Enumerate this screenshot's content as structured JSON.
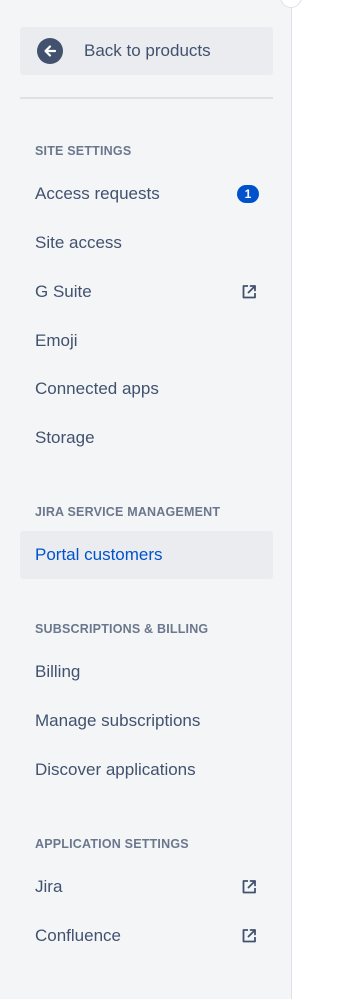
{
  "back": {
    "label": "Back to products"
  },
  "sections": {
    "site_settings": {
      "heading": "SITE SETTINGS",
      "items": [
        {
          "label": "Access requests",
          "badge": "1"
        },
        {
          "label": "Site access"
        },
        {
          "label": "G Suite",
          "icon": "external-link-icon"
        },
        {
          "label": "Emoji"
        },
        {
          "label": "Connected apps"
        },
        {
          "label": "Storage"
        }
      ]
    },
    "jira_service_management": {
      "heading": "JIRA SERVICE MANAGEMENT",
      "items": [
        {
          "label": "Portal customers",
          "selected": true
        }
      ]
    },
    "subscriptions_billing": {
      "heading": "SUBSCRIPTIONS & BILLING",
      "items": [
        {
          "label": "Billing"
        },
        {
          "label": "Manage subscriptions"
        },
        {
          "label": "Discover applications"
        }
      ]
    },
    "application_settings": {
      "heading": "APPLICATION SETTINGS",
      "items": [
        {
          "label": "Jira",
          "icon": "external-link-icon"
        },
        {
          "label": "Confluence",
          "icon": "external-link-icon"
        }
      ]
    }
  },
  "colors": {
    "sidebar_bg": "#f4f5f7",
    "text": "#42526e",
    "heading": "#6b778c",
    "selected_text": "#0052cc",
    "badge_bg": "#0052cc",
    "item_hover_bg": "#ebecf0"
  }
}
